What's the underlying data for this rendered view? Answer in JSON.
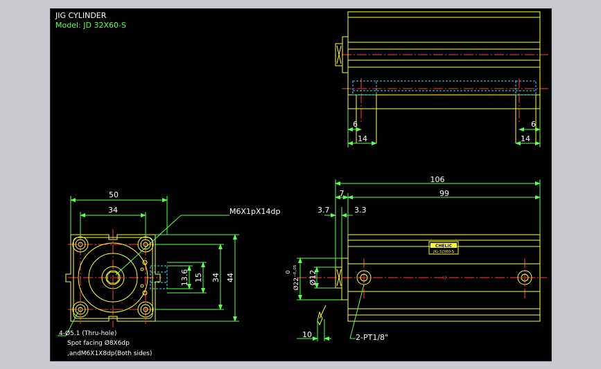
{
  "header": {
    "title": "JIG CYLINDER",
    "model": "Model: JD 32X60-S"
  },
  "front_view": {
    "dim_width_outer": "50",
    "dim_width_inner": "34",
    "callout_thread": "M6X1pX14dp",
    "dim_13_6": "13.6",
    "dim_15": "15",
    "dim_34_v": "34",
    "dim_44_v": "44",
    "note_line1": "4-Ø5.1 (Thru-hole)",
    "note_line2": "Spot facing Ø8X6dp",
    "note_line3": ",andM6X1X8dp(Both sides)"
  },
  "side_view": {
    "dim_overall": "106",
    "dim_7": "7",
    "dim_99": "99",
    "dim_3_7": "3.7",
    "dim_3_3": "3.3",
    "dim_rod_dia": "Ø22⁻⁰·⁰⁵",
    "dim_rod_tol": "0",
    "dim_12": "Ø12",
    "dim_10": "10",
    "port_callout": "2-PT1/8\"",
    "brand_label": "CHELIC",
    "brand_sub": "JIG-32X60-S"
  },
  "top_view": {
    "dim_6_left": "6",
    "dim_14_left": "14",
    "dim_6_right": "6",
    "dim_14_right": "14"
  },
  "colors": {
    "outline": "#ffff3c",
    "dimension": "#5cff52",
    "centerline": "#ff4040",
    "hidden": "#40e0ff",
    "background": "#000000"
  }
}
